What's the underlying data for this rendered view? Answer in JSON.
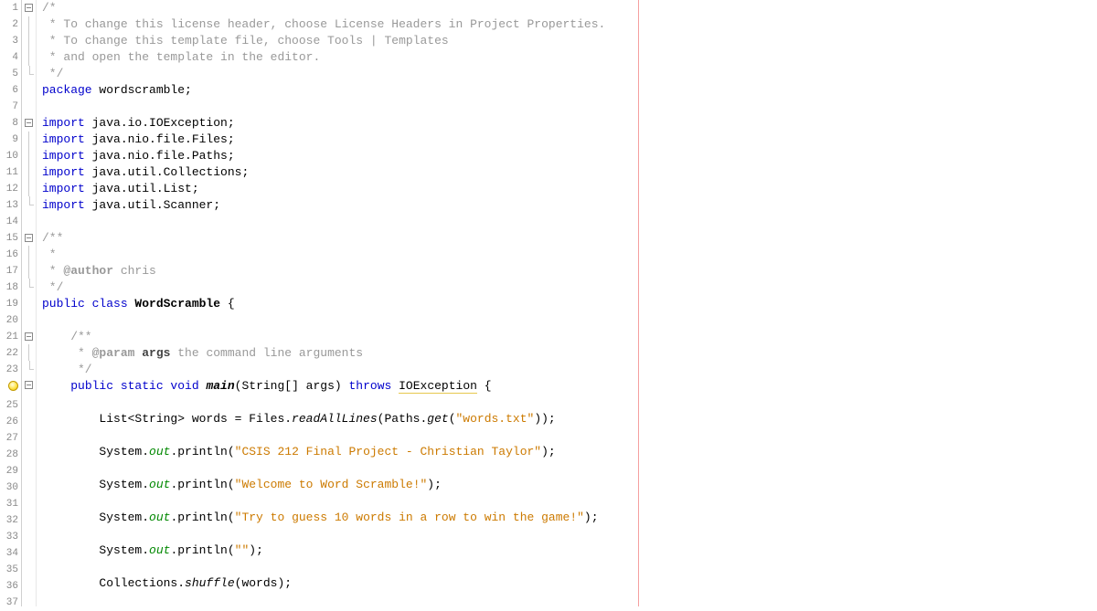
{
  "lines": [
    {
      "num": "1",
      "fold": "minus"
    },
    {
      "num": "2",
      "fold": "line"
    },
    {
      "num": "3",
      "fold": "line"
    },
    {
      "num": "4",
      "fold": "line"
    },
    {
      "num": "5",
      "fold": "end"
    },
    {
      "num": "6",
      "fold": ""
    },
    {
      "num": "7",
      "fold": ""
    },
    {
      "num": "8",
      "fold": "minus"
    },
    {
      "num": "9",
      "fold": "line"
    },
    {
      "num": "10",
      "fold": "line"
    },
    {
      "num": "11",
      "fold": "line"
    },
    {
      "num": "12",
      "fold": "line"
    },
    {
      "num": "13",
      "fold": "end"
    },
    {
      "num": "14",
      "fold": ""
    },
    {
      "num": "15",
      "fold": "minus"
    },
    {
      "num": "16",
      "fold": "line"
    },
    {
      "num": "17",
      "fold": "line"
    },
    {
      "num": "18",
      "fold": "end"
    },
    {
      "num": "19",
      "fold": ""
    },
    {
      "num": "20",
      "fold": ""
    },
    {
      "num": "21",
      "fold": "minus"
    },
    {
      "num": "22",
      "fold": "line"
    },
    {
      "num": "23",
      "fold": "end"
    },
    {
      "num": "24",
      "fold": "minus",
      "hint": true,
      "hideNum": true
    },
    {
      "num": "25",
      "fold": ""
    },
    {
      "num": "26",
      "fold": ""
    },
    {
      "num": "27",
      "fold": ""
    },
    {
      "num": "28",
      "fold": ""
    },
    {
      "num": "29",
      "fold": ""
    },
    {
      "num": "30",
      "fold": ""
    },
    {
      "num": "31",
      "fold": ""
    },
    {
      "num": "32",
      "fold": ""
    },
    {
      "num": "33",
      "fold": ""
    },
    {
      "num": "34",
      "fold": ""
    },
    {
      "num": "35",
      "fold": ""
    },
    {
      "num": "36",
      "fold": ""
    },
    {
      "num": "37",
      "fold": ""
    }
  ],
  "code": {
    "l1": "/*",
    "l2": " * To change this license header, choose License Headers in Project Properties.",
    "l3": " * To change this template file, choose Tools | Templates",
    "l4": " * and open the template in the editor.",
    "l5": " */",
    "l6_kw": "package",
    "l6_txt": " wordscramble;",
    "l8_kw": "import",
    "l8_txt": " java.io.IOException;",
    "l9_kw": "import",
    "l9_txt": " java.nio.file.Files;",
    "l10_kw": "import",
    "l10_txt": " java.nio.file.Paths;",
    "l11_kw": "import",
    "l11_txt": " java.util.Collections;",
    "l12_kw": "import",
    "l12_txt": " java.util.List;",
    "l13_kw": "import",
    "l13_txt": " java.util.Scanner;",
    "l15": "/**",
    "l16": " *",
    "l17a": " * ",
    "l17b": "@author",
    "l17c": " chris",
    "l18": " */",
    "l19a": "public class ",
    "l19b": "WordScramble",
    "l19c": " {",
    "l21": "    /**",
    "l22a": "     * ",
    "l22b": "@param",
    "l22c": " ",
    "l22d": "args",
    "l22e": " the command line arguments",
    "l23": "     */",
    "l24a": "    ",
    "l24b": "public static void ",
    "l24c": "main",
    "l24d": "(String[] args) ",
    "l24e": "throws",
    "l24f": " ",
    "l24g": "IOException",
    "l24h": " {",
    "l26a": "        List<String> words = Files.",
    "l26b": "readAllLines",
    "l26c": "(Paths.",
    "l26d": "get",
    "l26e": "(",
    "l26f": "\"words.txt\"",
    "l26g": "));",
    "l28a": "        System.",
    "l28b": "out",
    "l28c": ".println(",
    "l28d": "\"CSIS 212 Final Project - Christian Taylor\"",
    "l28e": ");",
    "l30a": "        System.",
    "l30b": "out",
    "l30c": ".println(",
    "l30d": "\"Welcome to Word Scramble!\"",
    "l30e": ");",
    "l32a": "        System.",
    "l32b": "out",
    "l32c": ".println(",
    "l32d": "\"Try to guess 10 words in a row to win the game!\"",
    "l32e": ");",
    "l34a": "        System.",
    "l34b": "out",
    "l34c": ".println(",
    "l34d": "\"\"",
    "l34e": ");",
    "l36a": "        Collections.",
    "l36b": "shuffle",
    "l36c": "(words);"
  }
}
